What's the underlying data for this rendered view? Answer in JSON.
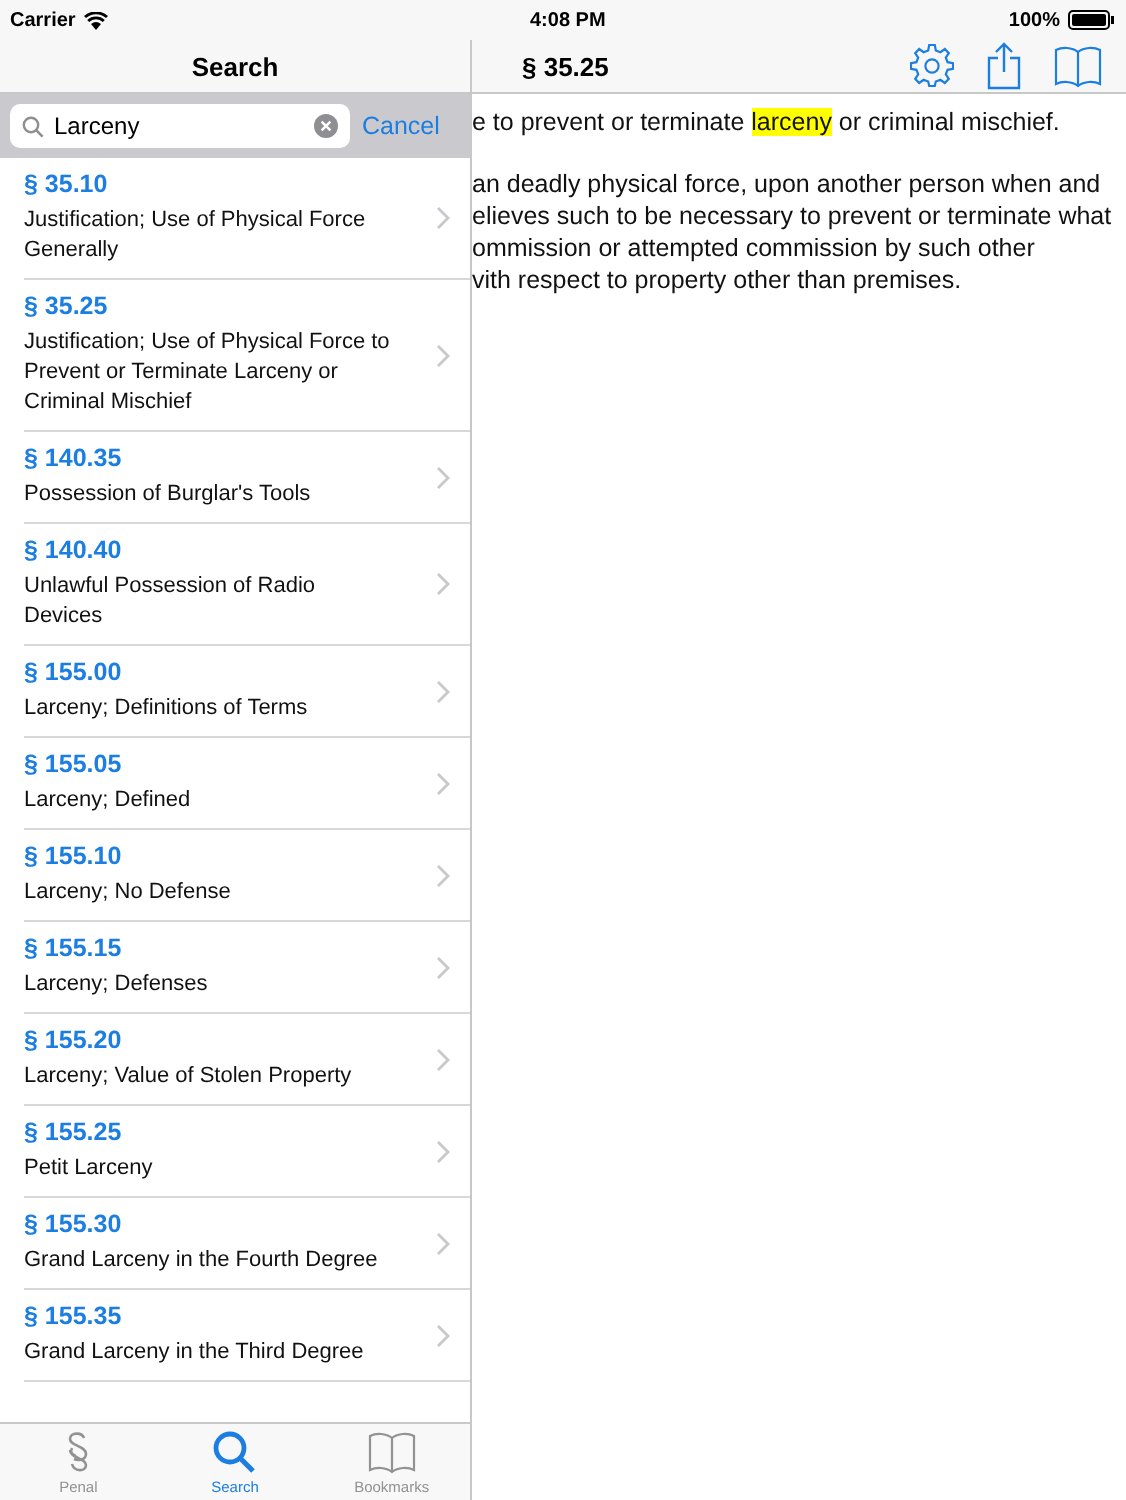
{
  "status_bar": {
    "carrier": "Carrier",
    "time": "4:08 PM",
    "battery": "100%"
  },
  "search_panel": {
    "title": "Search",
    "search_field": {
      "value": "Larceny"
    },
    "cancel": "Cancel",
    "results": [
      {
        "section": "§ 35.10",
        "title": "Justification; Use of Physical Force Generally"
      },
      {
        "section": "§ 35.25",
        "title": "Justification; Use of Physical Force to Prevent or Terminate Larceny or Criminal Mischief"
      },
      {
        "section": "§ 140.35",
        "title": "Possession of Burglar's Tools"
      },
      {
        "section": "§ 140.40",
        "title": "Unlawful Possession of Radio Devices"
      },
      {
        "section": "§ 155.00",
        "title": "Larceny; Definitions of Terms"
      },
      {
        "section": "§ 155.05",
        "title": "Larceny; Defined"
      },
      {
        "section": "§ 155.10",
        "title": "Larceny; No Defense"
      },
      {
        "section": "§ 155.15",
        "title": "Larceny; Defenses"
      },
      {
        "section": "§ 155.20",
        "title": "Larceny; Value of Stolen Property"
      },
      {
        "section": "§ 155.25",
        "title": "Petit Larceny"
      },
      {
        "section": "§ 155.30",
        "title": "Grand Larceny in the Fourth Degree"
      },
      {
        "section": "§ 155.35",
        "title": "Grand Larceny in the Third Degree"
      }
    ],
    "tabs": [
      {
        "label": "Penal",
        "selected": false
      },
      {
        "label": "Search",
        "selected": true
      },
      {
        "label": "Bookmarks",
        "selected": false
      }
    ]
  },
  "detail": {
    "title": "§ 35.25",
    "paragraphs": [
      {
        "lines": [
          {
            "before": "e to prevent or terminate ",
            "highlight": "larceny",
            "after": " or criminal mischief."
          }
        ]
      },
      {
        "lines": [
          {
            "before": "an deadly physical force, upon another person when and"
          },
          {
            "before": "elieves such to be necessary to prevent or terminate what"
          },
          {
            "before": "ommission or attempted commission by such other"
          },
          {
            "before": "vith respect to property other than premises."
          }
        ]
      }
    ]
  }
}
